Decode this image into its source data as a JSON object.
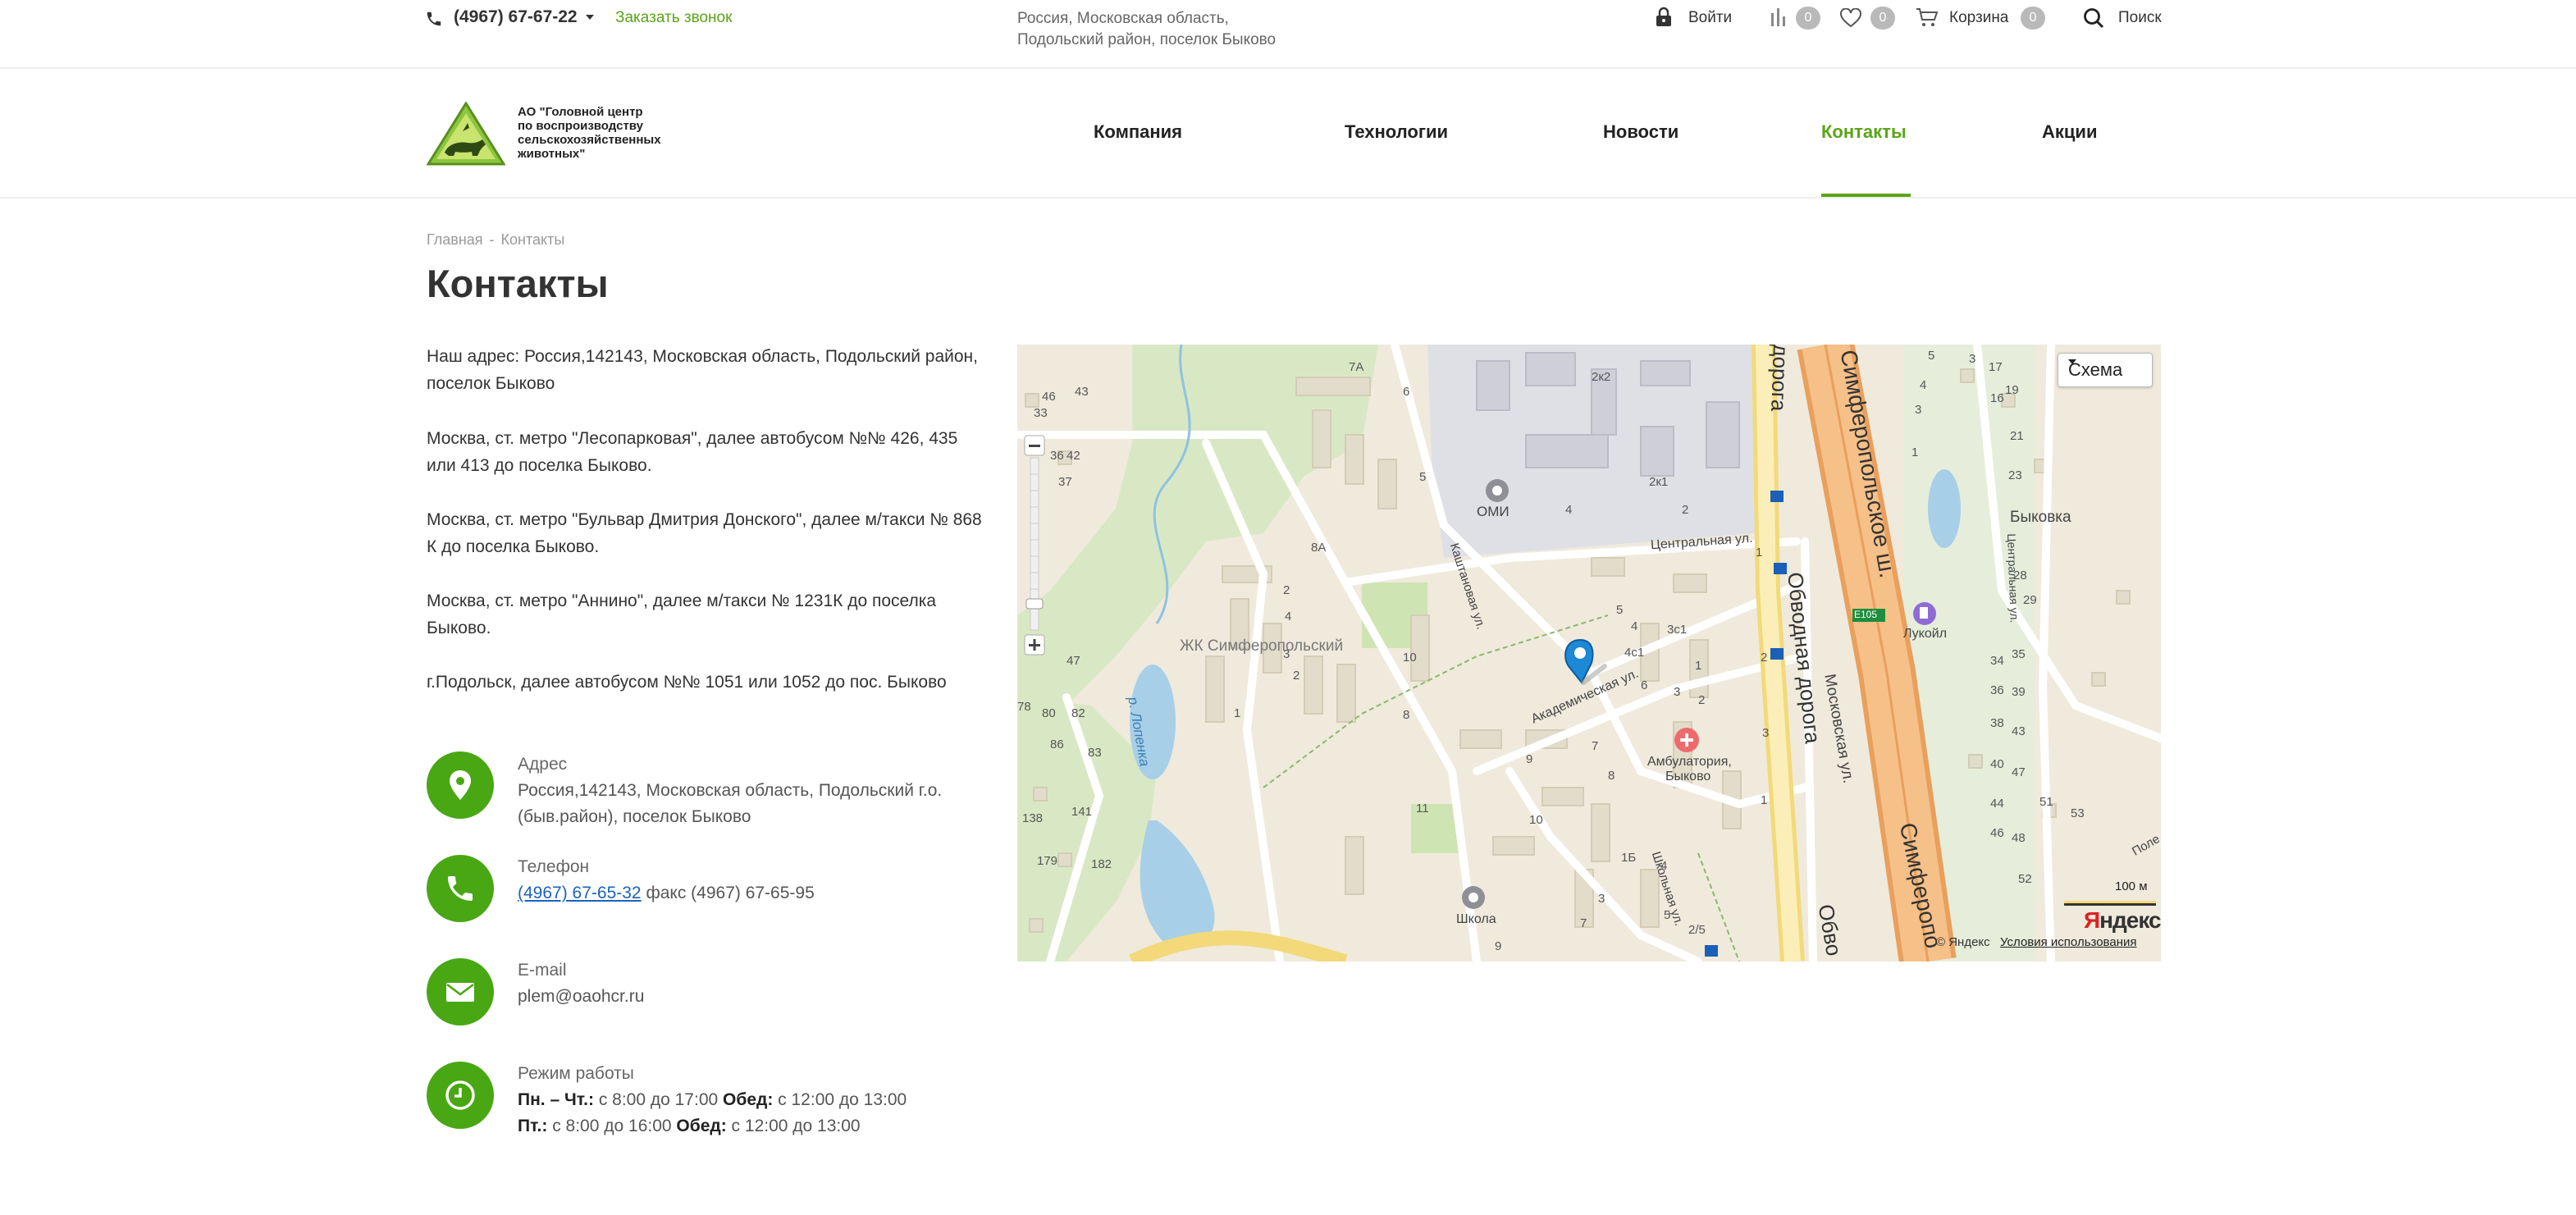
{
  "topbar": {
    "phone": "(4967) 67-67-22",
    "callback": "Заказать звонок",
    "address_line1": "Россия, Московская область,",
    "address_line2": "Подольский район, поселок Быково",
    "login": "Войти",
    "compare_count": "0",
    "favorites_count": "0",
    "cart_label": "Корзина",
    "cart_count": "0",
    "search_label": "Поиск"
  },
  "logo": {
    "line1": "АО \"Головной центр",
    "line2": "по воспроизводству",
    "line3": "сельскохозяйственных",
    "line4": "животных\""
  },
  "nav": {
    "items": [
      {
        "label": "Компания"
      },
      {
        "label": "Технологии"
      },
      {
        "label": "Новости"
      },
      {
        "label": "Контакты"
      },
      {
        "label": "Акции"
      }
    ],
    "active": "Контакты"
  },
  "breadcrumb": {
    "home": "Главная",
    "sep": "-",
    "current": "Контакты"
  },
  "page_title": "Контакты",
  "directions": [
    "Наш адрес: Россия,142143, Московская область, Подольский район, поселок Быково",
    "Москва, ст. метро \"Лесопарковая\", далее автобусом №№ 426, 435 или 413 до поселка Быково.",
    "Москва, ст. метро \"Бульвар Дмитрия Донского\", далее м/такси № 868 К до поселка Быково.",
    "Москва, ст. метро \"Аннино\", далее м/такси № 1231К до поселка Быково.",
    "г.Подольск, далее автобусом №№ 1051 или 1052 до пос. Быково"
  ],
  "contacts": {
    "address_label": "Адрес",
    "address_value": "Россия,142143, Московская область, Подольский г.о. (быв.район), поселок Быково",
    "phone_label": "Телефон",
    "phone_link": "(4967) 67-65-32",
    "phone_fax": " факс (4967) 67-65-95",
    "email_label": "E-mail",
    "email_value": "plem@oaohcr.ru",
    "hours_label": "Режим работы",
    "hours_row1_days": "Пн. – Чт.:",
    "hours_row1_time": " с 8:00 до 17:00 ",
    "hours_row1_break_label": "Обед:",
    "hours_row1_break": " с 12:00 до 13:00",
    "hours_row2_days": "Пт.:",
    "hours_row2_time": " с 8:00 до 16:00 ",
    "hours_row2_break_label": "Обед:",
    "hours_row2_break": " с 12:00 до 13:00"
  },
  "map": {
    "scheme_button": "Схема",
    "labels": {
      "omi": "ОМИ",
      "zhk": "ЖК Симферопольский",
      "river": "р. Лопенка",
      "tsentralnaya": "Центральная ул.",
      "kashtanovaya": "Каштановая ул.",
      "akademicheskaya": "Академическая ул.",
      "ambulatoria1": "Амбулатория,",
      "ambulatoria2": "Быково",
      "shkola": "Школа",
      "shkolnaya": "Школьная ул.",
      "moskovskaya": "Московская ул.",
      "obvodnaya": "Обводная дорога",
      "obvodnaya_top": "дорога",
      "obvodnaya_bottom": "Обво",
      "simferopolskoe": "Симферопольское ш.",
      "simferopol_bottom": "Симферопо",
      "bykovka": "Быковка",
      "lukoil": "Лукойл",
      "e105": "E105",
      "pole": "Поле",
      "tsentralnaya_right": "Центральная ул."
    },
    "scale": "100 м",
    "copyright": "© Яндекс",
    "terms": "Условия использования",
    "yandex_logo_red": "Я",
    "yandex_logo_rest": "ндекс"
  },
  "colors": {
    "accent": "#5aa517",
    "contact_circle": "#48a713",
    "link": "#1a63bd"
  }
}
